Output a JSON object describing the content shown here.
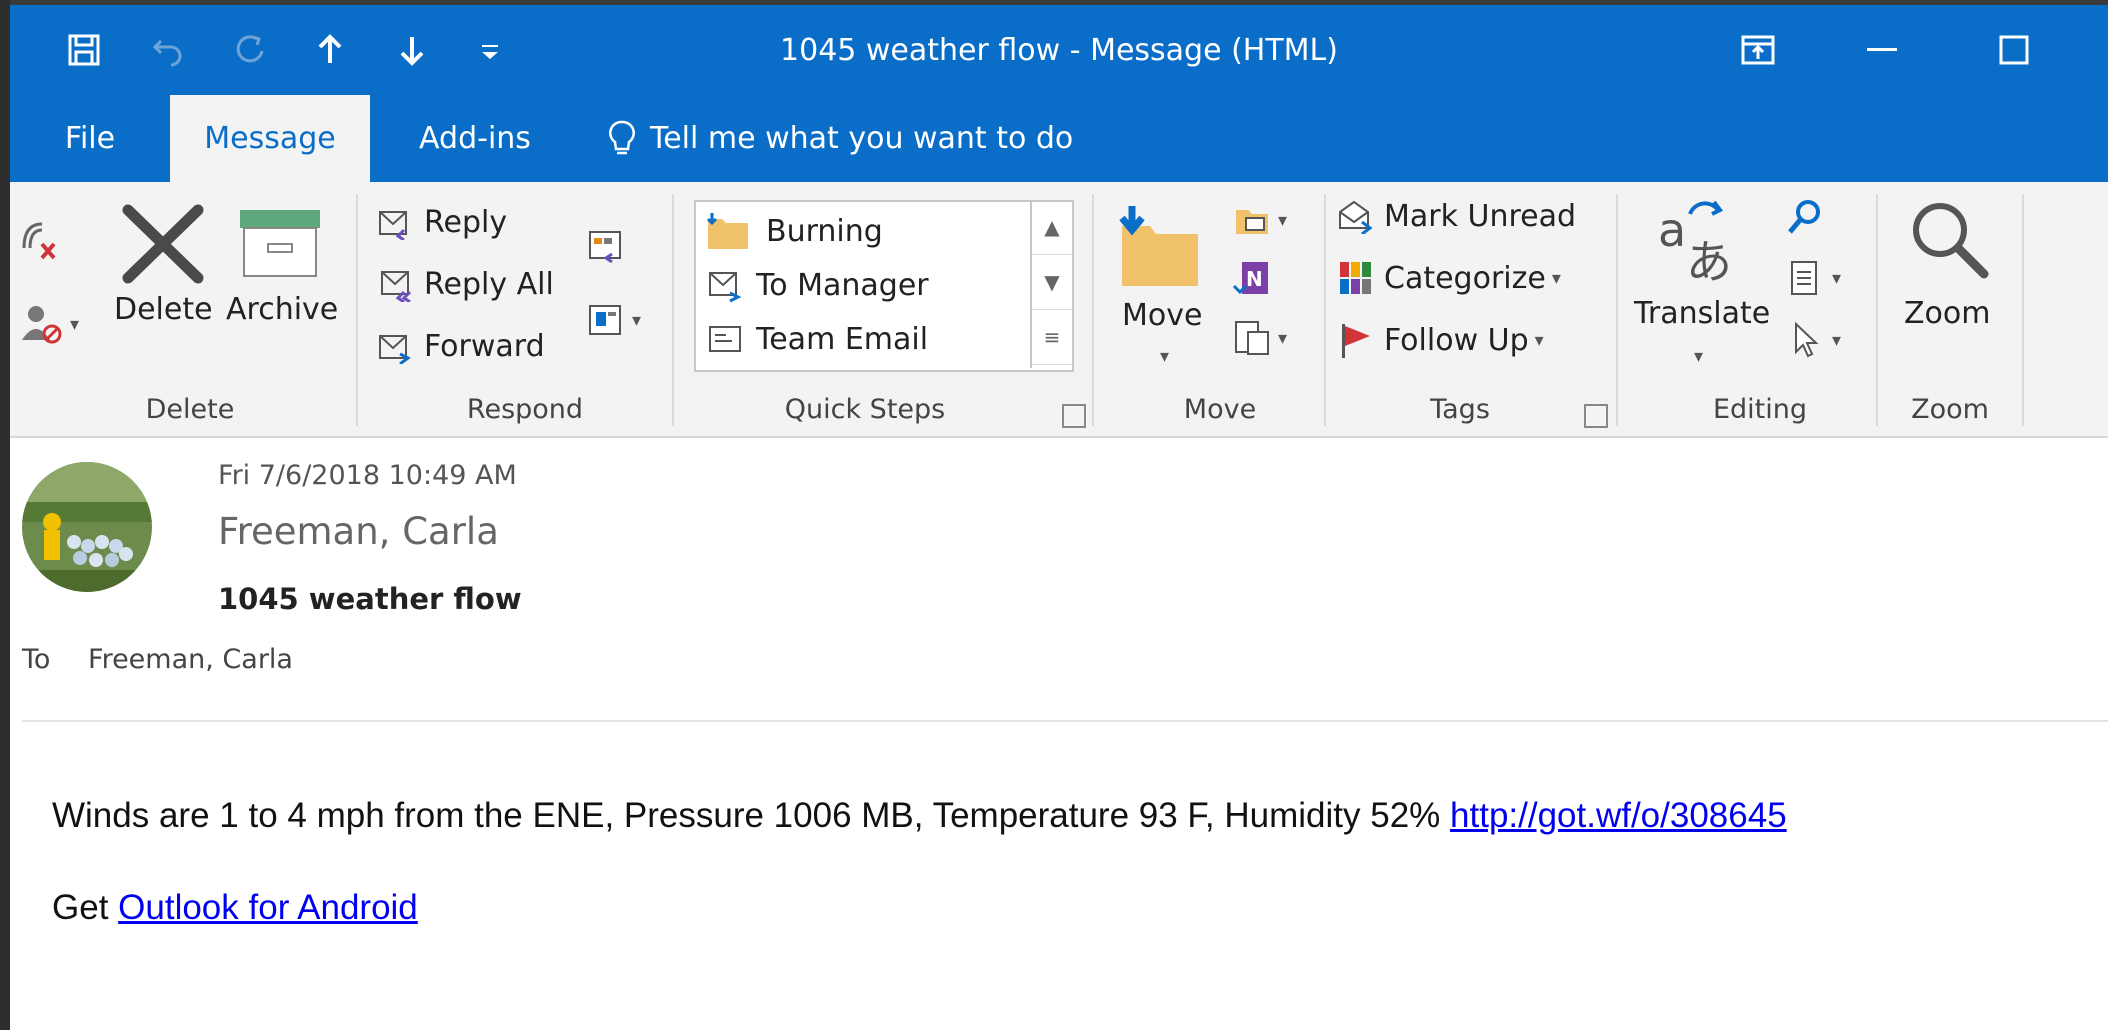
{
  "window": {
    "title": "1045 weather flow  -  Message (HTML)"
  },
  "quick_access": {
    "save": "save-icon",
    "undo": "undo-icon",
    "redo": "redo-icon",
    "previous": "up-arrow-icon",
    "next": "down-arrow-icon",
    "customize": "customize-icon"
  },
  "tabs": [
    {
      "label": "File"
    },
    {
      "label": "Message"
    },
    {
      "label": "Add-ins"
    }
  ],
  "tell_me": "Tell me what you want to do",
  "ribbon": {
    "delete_group": {
      "label": "Delete",
      "delete": "Delete",
      "archive": "Archive"
    },
    "respond_group": {
      "label": "Respond",
      "reply": "Reply",
      "reply_all": "Reply All",
      "forward": "Forward"
    },
    "quick_steps_group": {
      "label": "Quick Steps",
      "items": [
        "Burning",
        "To Manager",
        "Team Email"
      ]
    },
    "move_group": {
      "label": "Move",
      "move": "Move"
    },
    "tags_group": {
      "label": "Tags",
      "mark_unread": "Mark Unread",
      "categorize": "Categorize",
      "follow_up": "Follow Up"
    },
    "editing_group": {
      "label": "Editing",
      "translate": "Translate"
    },
    "zoom_group": {
      "label": "Zoom",
      "zoom": "Zoom"
    }
  },
  "message": {
    "date": "Fri 7/6/2018 10:49 AM",
    "from": "Freeman, Carla",
    "subject": "1045 weather flow",
    "to_label": "To",
    "to": "Freeman, Carla",
    "body_text": "Winds are 1 to 4 mph from the ENE, Pressure 1006 MB, Temperature 93 F, Humidity 52%",
    "body_link": "http://got.wf/o/308645",
    "signature_prefix": "Get",
    "signature_link": "Outlook for Android"
  },
  "colors": {
    "accent": "#0a6ec9",
    "ribbon_bg": "#f3f3f3",
    "link": "#0000ee"
  }
}
